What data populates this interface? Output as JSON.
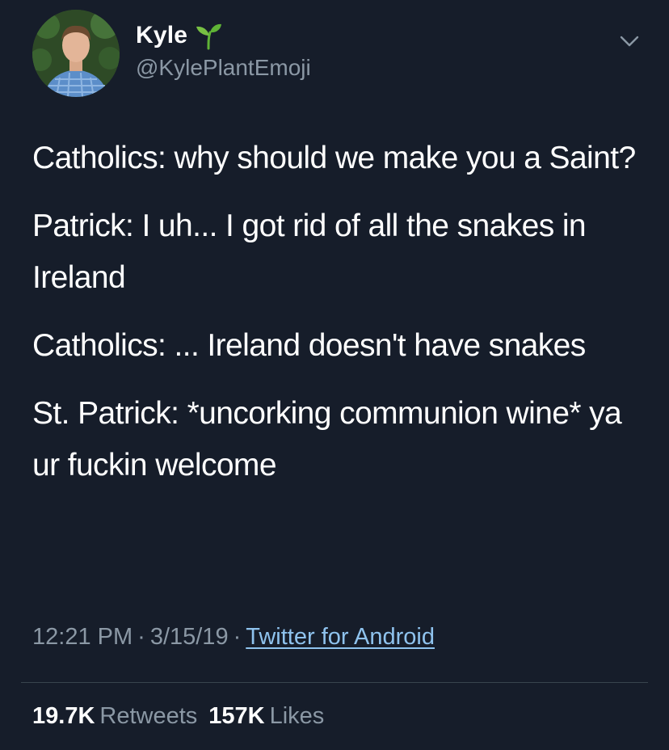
{
  "user": {
    "display_name": "Kyle",
    "handle": "@KylePlantEmoji",
    "name_emoji_icon": "seedling-icon",
    "avatar_icon": "profile-photo"
  },
  "menu": {
    "icon": "chevron-down-icon"
  },
  "tweet": {
    "paragraphs": [
      "Catholics: why should we make you a Saint?",
      "Patrick: I uh... I got rid of all the snakes in Ireland",
      "Catholics: ... Ireland doesn't have snakes",
      "St. Patrick: *uncorking communion wine* ya ur fuckin welcome"
    ],
    "time": "12:21 PM",
    "date": "3/15/19",
    "separator": "·",
    "source": "Twitter for Android"
  },
  "stats": {
    "retweets_count": "19.7K",
    "retweets_label": "Retweets",
    "likes_count": "157K",
    "likes_label": "Likes"
  },
  "colors": {
    "background": "#161d2a",
    "text": "#ffffff",
    "secondary_text": "#8b98a5",
    "link": "#8fc3ee",
    "divider": "#38444d",
    "sprout_green": "#5fb336"
  }
}
